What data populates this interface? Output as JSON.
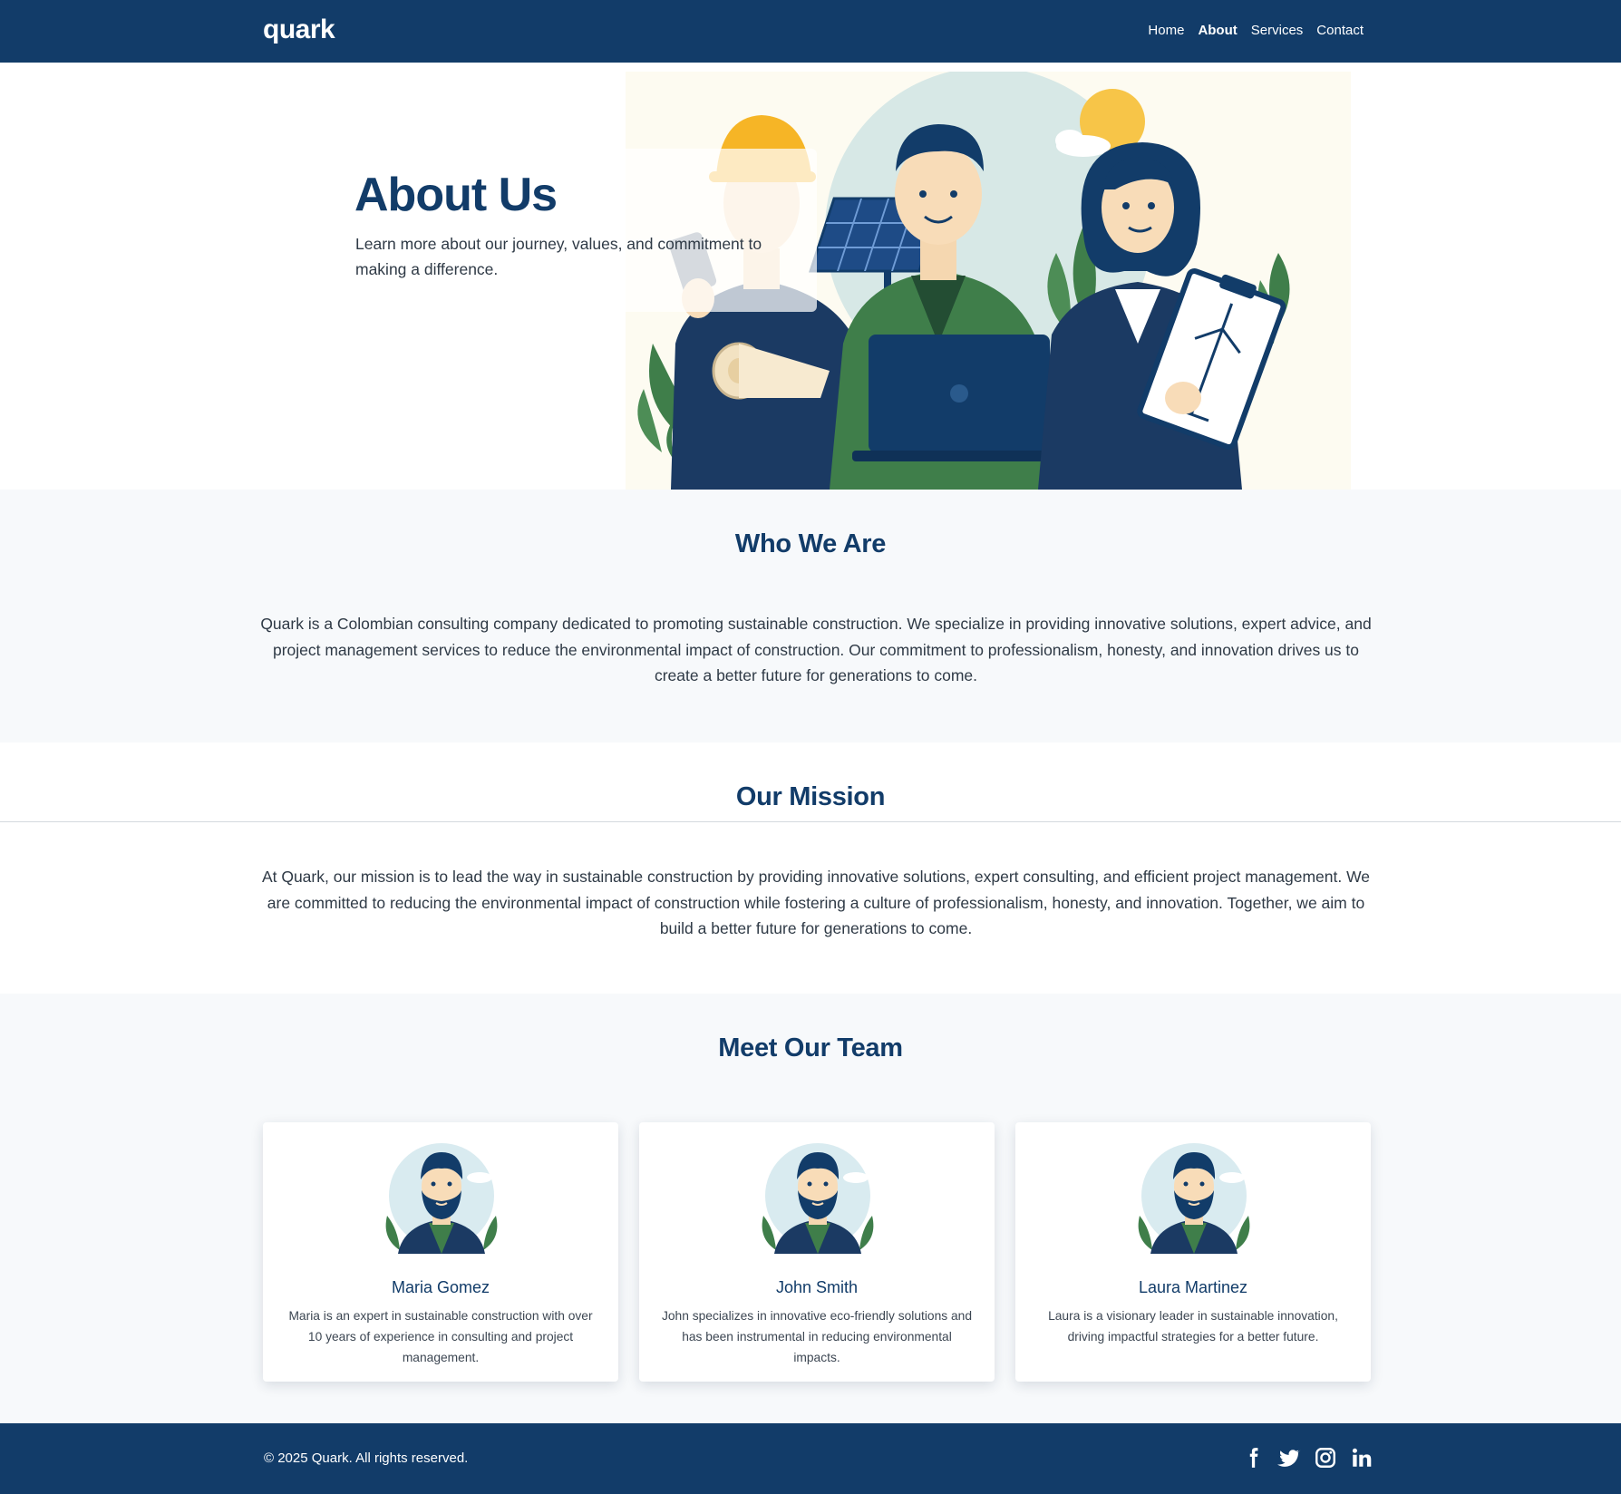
{
  "navbar": {
    "logo": "quark",
    "links": [
      {
        "label": "Home",
        "active": false
      },
      {
        "label": "About",
        "active": true
      },
      {
        "label": "Services",
        "active": false
      },
      {
        "label": "Contact",
        "active": false
      }
    ]
  },
  "hero": {
    "title": "About Us",
    "subtitle": "Learn more about our journey, values, and commitment to making a difference.",
    "illustration": "team-illustration-sustainable-construction"
  },
  "who_we_are": {
    "title": "Who We Are",
    "text": "Quark is a Colombian consulting company dedicated to promoting sustainable construction. We specialize in providing innovative solutions, expert advice, and project management services to reduce the environmental impact of construction. Our commitment to professionalism, honesty, and innovation drives us to create a better future for generations to come."
  },
  "mission": {
    "title": "Our Mission",
    "text": "At Quark, our mission is to lead the way in sustainable construction by providing innovative solutions, expert consulting, and efficient project management. We are committed to reducing the environmental impact of construction while fostering a culture of professionalism, honesty, and innovation. Together, we aim to build a better future for generations to come."
  },
  "team": {
    "title": "Meet Our Team",
    "members": [
      {
        "name": "Maria Gomez",
        "bio": "Maria is an expert in sustainable construction with over 10 years of experience in consulting and project management.",
        "avatar": "bearded-man-avatar"
      },
      {
        "name": "John Smith",
        "bio": "John specializes in innovative eco-friendly solutions and has been instrumental in reducing environmental impacts.",
        "avatar": "bearded-man-avatar"
      },
      {
        "name": "Laura Martinez",
        "bio": "Laura is a visionary leader in sustainable innovation, driving impactful strategies for a better future.",
        "avatar": "bearded-man-avatar"
      }
    ]
  },
  "footer": {
    "copyright": "© 2025 Quark. All rights reserved.",
    "socials": [
      "facebook-icon",
      "twitter-icon",
      "instagram-icon",
      "linkedin-icon"
    ]
  },
  "colors": {
    "primary": "#123c69",
    "section_bg": "#f7f9fb",
    "accent_green": "#3f7e4a",
    "accent_yellow": "#f7c548"
  }
}
